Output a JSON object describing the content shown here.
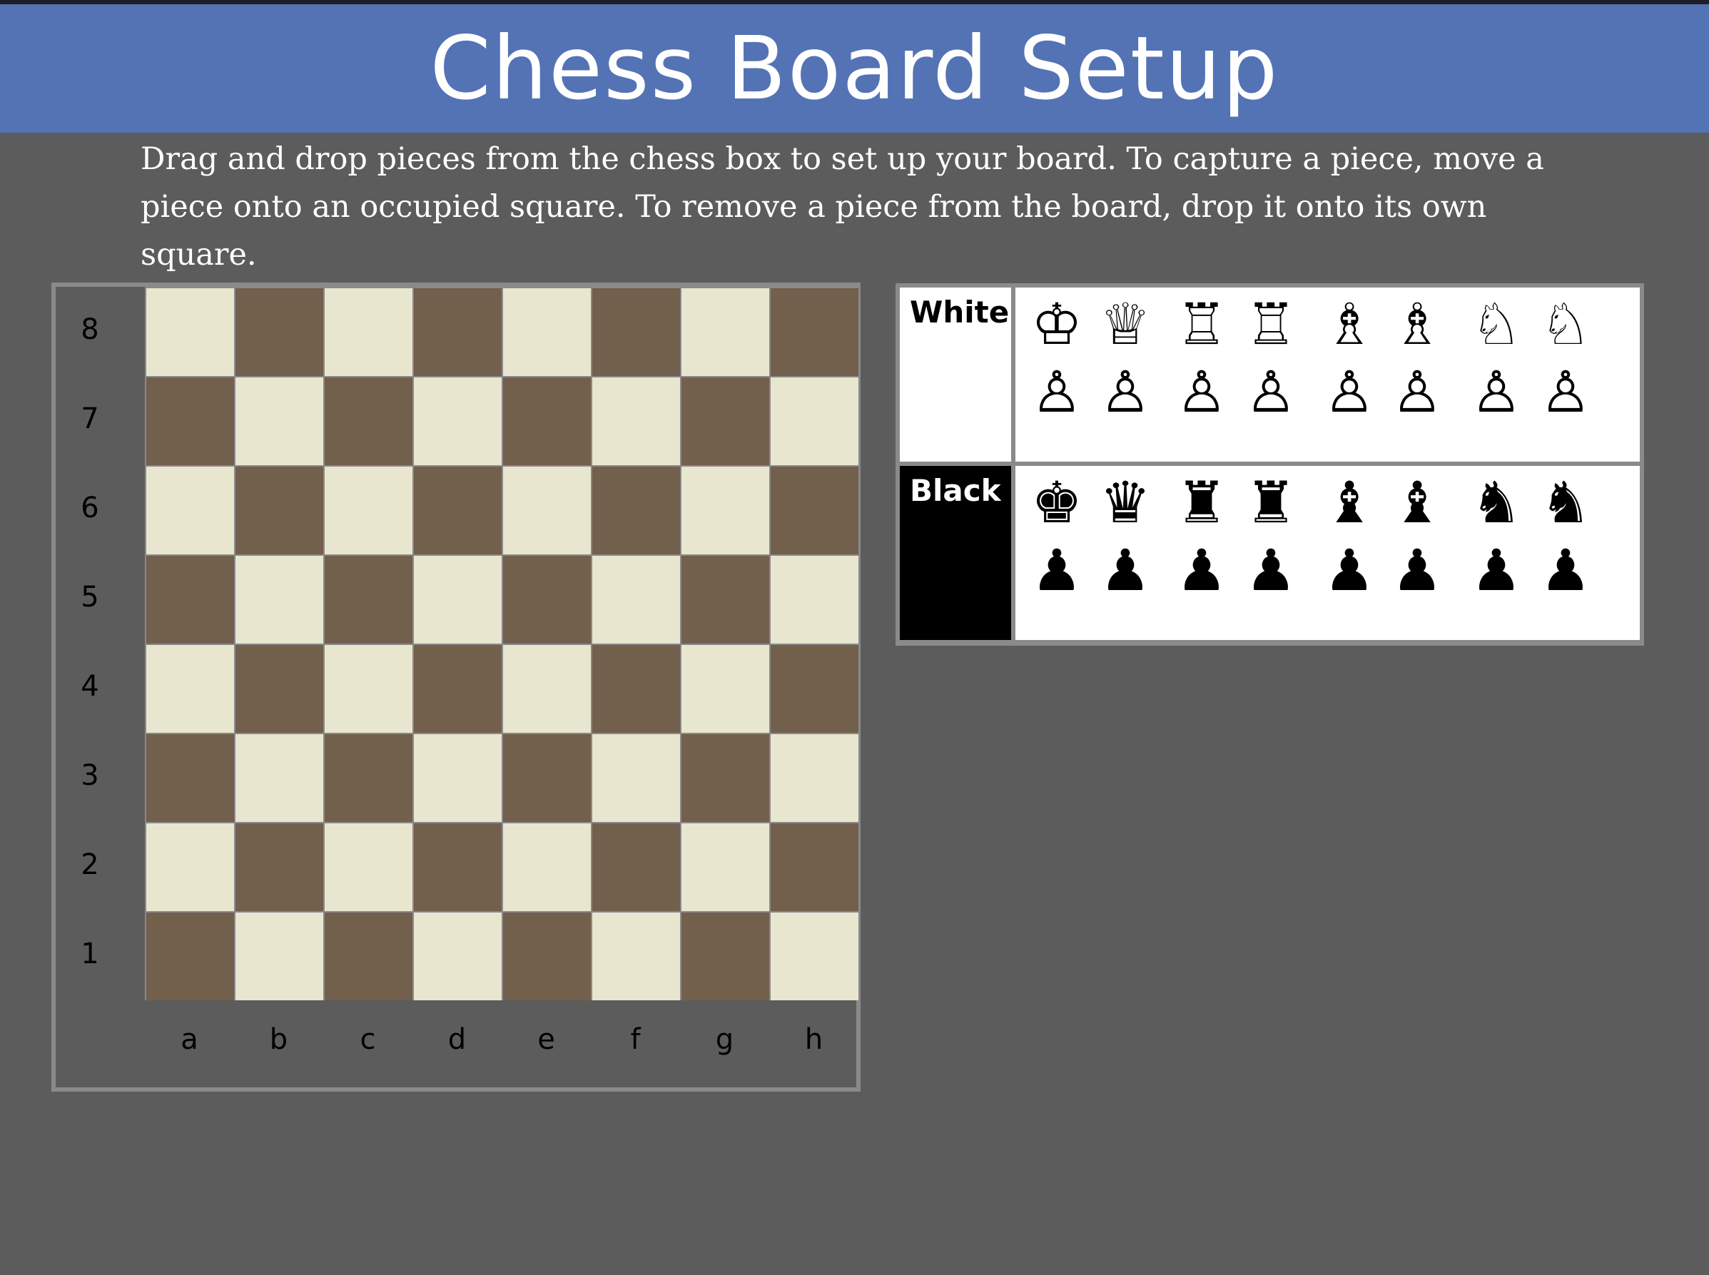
{
  "header": {
    "title": "Chess Board Setup",
    "bg_color": "#5473b5"
  },
  "intro": {
    "text": "Drag and drop pieces from the chess box to set up your board. To capture a piece, move a piece onto an occupied square. To remove a piece from the board, drop it onto its own square."
  },
  "board": {
    "ranks": [
      "8",
      "7",
      "6",
      "5",
      "4",
      "3",
      "2",
      "1"
    ],
    "files": [
      "a",
      "b",
      "c",
      "d",
      "e",
      "f",
      "g",
      "h"
    ],
    "light_color": "#e8e6cf",
    "dark_color": "#725f4c"
  },
  "chess_box": {
    "white": {
      "label": "White",
      "back_row": [
        {
          "name": "white-king",
          "glyph": "♔"
        },
        {
          "name": "white-queen",
          "glyph": "♕"
        },
        {
          "name": "white-rook",
          "glyph": "♖"
        },
        {
          "name": "white-rook",
          "glyph": "♖"
        },
        {
          "name": "white-bishop",
          "glyph": "♗"
        },
        {
          "name": "white-bishop",
          "glyph": "♗"
        },
        {
          "name": "white-knight",
          "glyph": "♘"
        },
        {
          "name": "white-knight",
          "glyph": "♘"
        }
      ],
      "pawn_row": [
        {
          "name": "white-pawn",
          "glyph": "♙"
        },
        {
          "name": "white-pawn",
          "glyph": "♙"
        },
        {
          "name": "white-pawn",
          "glyph": "♙"
        },
        {
          "name": "white-pawn",
          "glyph": "♙"
        },
        {
          "name": "white-pawn",
          "glyph": "♙"
        },
        {
          "name": "white-pawn",
          "glyph": "♙"
        },
        {
          "name": "white-pawn",
          "glyph": "♙"
        },
        {
          "name": "white-pawn",
          "glyph": "♙"
        }
      ]
    },
    "black": {
      "label": "Black",
      "back_row": [
        {
          "name": "black-king",
          "glyph": "♚"
        },
        {
          "name": "black-queen",
          "glyph": "♛"
        },
        {
          "name": "black-rook",
          "glyph": "♜"
        },
        {
          "name": "black-rook",
          "glyph": "♜"
        },
        {
          "name": "black-bishop",
          "glyph": "♝"
        },
        {
          "name": "black-bishop",
          "glyph": "♝"
        },
        {
          "name": "black-knight",
          "glyph": "♞"
        },
        {
          "name": "black-knight",
          "glyph": "♞"
        }
      ],
      "pawn_row": [
        {
          "name": "black-pawn",
          "glyph": "♟"
        },
        {
          "name": "black-pawn",
          "glyph": "♟"
        },
        {
          "name": "black-pawn",
          "glyph": "♟"
        },
        {
          "name": "black-pawn",
          "glyph": "♟"
        },
        {
          "name": "black-pawn",
          "glyph": "♟"
        },
        {
          "name": "black-pawn",
          "glyph": "♟"
        },
        {
          "name": "black-pawn",
          "glyph": "♟"
        },
        {
          "name": "black-pawn",
          "glyph": "♟"
        }
      ]
    }
  }
}
